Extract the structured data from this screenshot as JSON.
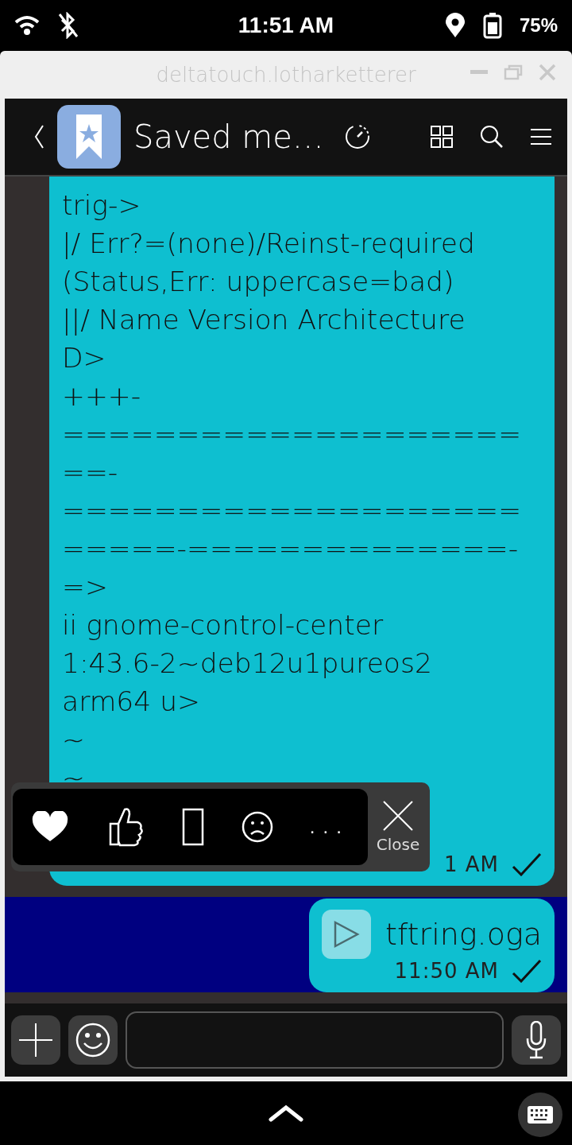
{
  "status_bar": {
    "time": "11:51 AM",
    "battery": "75%"
  },
  "window": {
    "title": "deltatouch.lotharketterer"
  },
  "header": {
    "title": "Saved me…"
  },
  "messages": [
    {
      "kind": "text",
      "lines": [
        "trig->",
        "|/ Err?=(none)/Reinst-required",
        "(Status,Err: uppercase=bad)",
        "||/ Name Version Architecture",
        "D>",
        "+++-",
        "====================",
        "==-",
        "====================",
        "=====-==============-",
        "=>",
        "ii gnome-control-center",
        "1:43.6-2~deb12u1pureos2",
        "arm64 u>",
        "~",
        "~"
      ],
      "time": "1 AM",
      "delivered": true,
      "selected": false
    },
    {
      "kind": "audio",
      "filename": "tftring.oga",
      "time": "11:50 AM",
      "delivered": true,
      "selected": true
    }
  ],
  "reaction_bar": {
    "reactions": [
      {
        "kind": "heart"
      },
      {
        "kind": "thumbs"
      },
      {
        "kind": "missing"
      },
      {
        "kind": "frown"
      },
      {
        "kind": "more",
        "label": "..."
      }
    ],
    "close": "Close"
  }
}
